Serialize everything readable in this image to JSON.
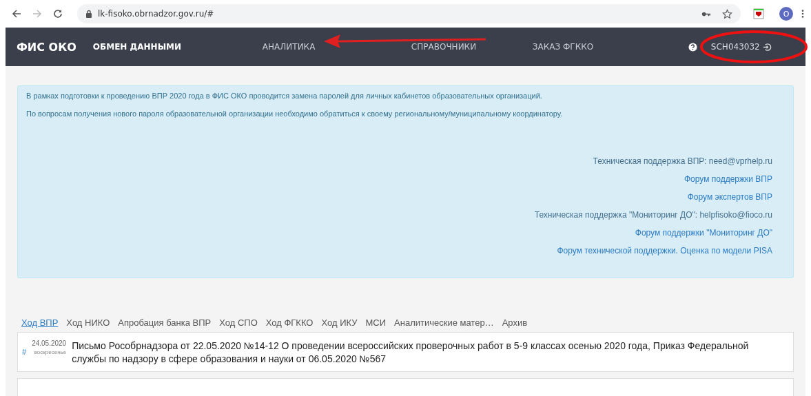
{
  "browser": {
    "url": "lk-fisoko.obrnadzor.gov.ru/#",
    "profile_initial": "O"
  },
  "nav": {
    "brand": "ФИС ОКО",
    "items": [
      {
        "label": "ОБМЕН ДАННЫМИ",
        "kind": "primary"
      },
      {
        "label": "АНАЛИТИКА",
        "kind": "menu"
      },
      {
        "label": "СПРАВОЧНИКИ",
        "kind": "menu"
      },
      {
        "label": "ЗАКАЗ ФГККО",
        "kind": "menu"
      }
    ],
    "user": "SCH043032"
  },
  "alert": {
    "paragraphs": [
      "В рамках подготовки к проведению ВПР 2020 года в ФИС ОКО проводится замена паролей для личных кабинетов образовательных организаций.",
      "По вопросам получения нового пароля образовательной организации необходимо обратиться к своему региональному/муниципальному координатору."
    ],
    "contacts": [
      {
        "text": "Техническая поддержка ВПР: need@vprhelp.ru",
        "kind": "text"
      },
      {
        "text": "Форум поддержки ВПР",
        "kind": "link"
      },
      {
        "text": "Форум экспертов ВПР",
        "kind": "link"
      },
      {
        "text": "Техническая поддержка \"Мониторинг ДО\": helpfisoko@fioco.ru",
        "kind": "text"
      },
      {
        "text": "Форум поддержки \"Мониторинг ДО\"",
        "kind": "link"
      },
      {
        "text": "Форум технической поддержки. Оценка по модели PISA",
        "kind": "link"
      }
    ]
  },
  "tabs": [
    {
      "label": "Ход ВПР",
      "selected": true
    },
    {
      "label": "Ход НИКО",
      "selected": false
    },
    {
      "label": "Апробация банка ВПР",
      "selected": false
    },
    {
      "label": "Ход СПО",
      "selected": false
    },
    {
      "label": "Ход ФГККО",
      "selected": false
    },
    {
      "label": "Ход ИКУ",
      "selected": false
    },
    {
      "label": "МСИ",
      "selected": false
    },
    {
      "label": "Аналитические матер…",
      "selected": false
    },
    {
      "label": "Архив",
      "selected": false
    }
  ],
  "news": [
    {
      "anchor": "#",
      "date": "24.05.2020",
      "weekday": "воскресенье",
      "title": "Письмо Рособрнадзора от 22.05.2020 №14-12 О проведении всероссийских проверочных работ в 5-9 классах осенью 2020 года, Приказ Федеральной службы по надзору в сфере образования и науки от 06.05.2020 №567"
    }
  ]
}
